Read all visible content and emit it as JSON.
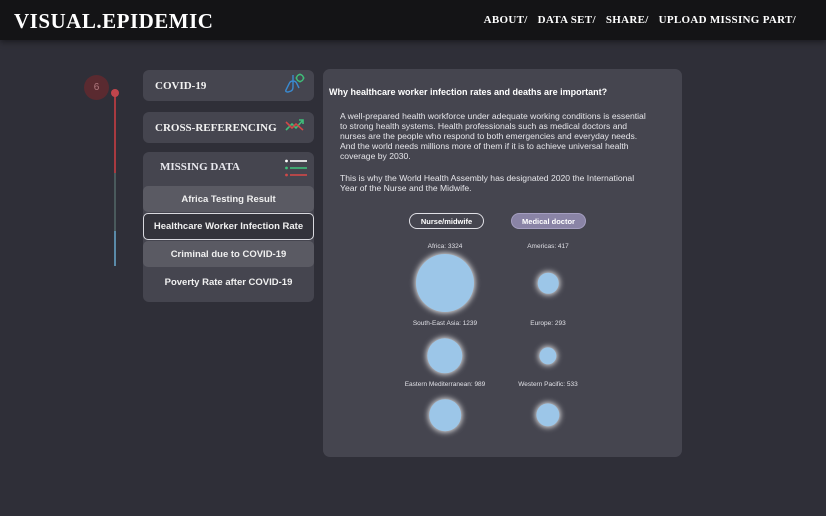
{
  "header": {
    "logo": "VISUAL.EPIDEMIC",
    "nav": [
      "ABOUT/",
      "DATA SET/",
      "SHARE/",
      "UPLOAD MISSING PART/"
    ]
  },
  "timeline": {
    "step_number": "6"
  },
  "menu": {
    "covid": "COVID-19",
    "cross": "CROSS-REFERENCING",
    "missing": {
      "title": "MISSING DATA",
      "items": [
        "Africa Testing Result",
        "Healthcare Worker Infection Rate",
        "Criminal due to COVID-19",
        "Poverty Rate after COVID-19"
      ],
      "active_index": 1
    }
  },
  "panel": {
    "title": "Why healthcare worker infection rates and deaths are important?",
    "para1": "A well-prepared health workforce under adequate working conditions is essential to strong health systems. Health professionals such as medical doctors and nurses are the people who respond to both emergencies and everyday needs. And the world needs millions more of them if it is to achieve universal health coverage by 2030.",
    "para2": "This is why the World Health Assembly has designated 2020 the International Year of the Nurse and the Midwife.",
    "toggle": {
      "nurse": "Nurse/midwife",
      "doctor": "Medical doctor",
      "selected": "doctor"
    }
  },
  "chart_data": {
    "type": "bubble",
    "series": [
      {
        "name": "Nurse/midwife",
        "regions": [
          "Africa",
          "South-East Asia",
          "Eastern Mediterranean"
        ],
        "values": [
          3324,
          1239,
          989
        ]
      },
      {
        "name": "Medical doctor",
        "regions": [
          "Americas",
          "Europe",
          "Western Pacific"
        ],
        "values": [
          417,
          293,
          533
        ]
      }
    ],
    "labels": [
      "Africa: 3324",
      "Americas: 417",
      "South-East Asia: 1239",
      "Europe: 293",
      "Eastern Mediterranean: 989",
      "Western Pacific: 533"
    ],
    "bubble_color": "#9cc6e8"
  },
  "colors": {
    "accent_red": "#c0454c",
    "background": "#2f2f38",
    "card": "#45454f"
  }
}
